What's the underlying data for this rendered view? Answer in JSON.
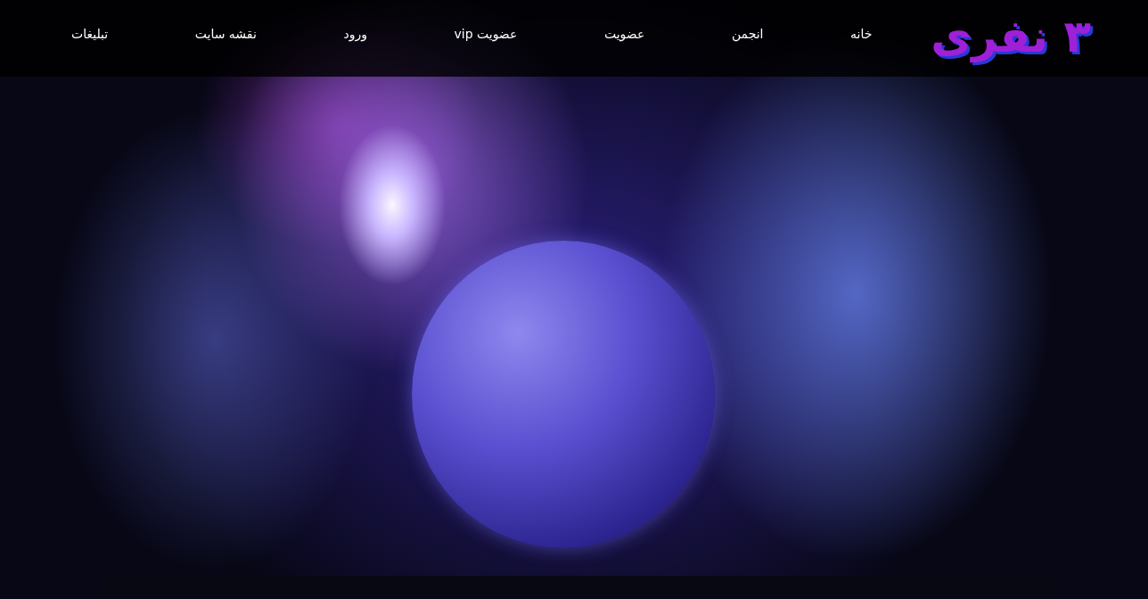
{
  "logo": {
    "text": "۳ نفری"
  },
  "nav": [
    {
      "label": "خانه"
    },
    {
      "label": "انجمن"
    },
    {
      "label": "عضویت"
    },
    {
      "label": "عضویت vip"
    },
    {
      "label": "ورود"
    },
    {
      "label": "نقشه سایت"
    },
    {
      "label": "تبلیغات"
    }
  ]
}
